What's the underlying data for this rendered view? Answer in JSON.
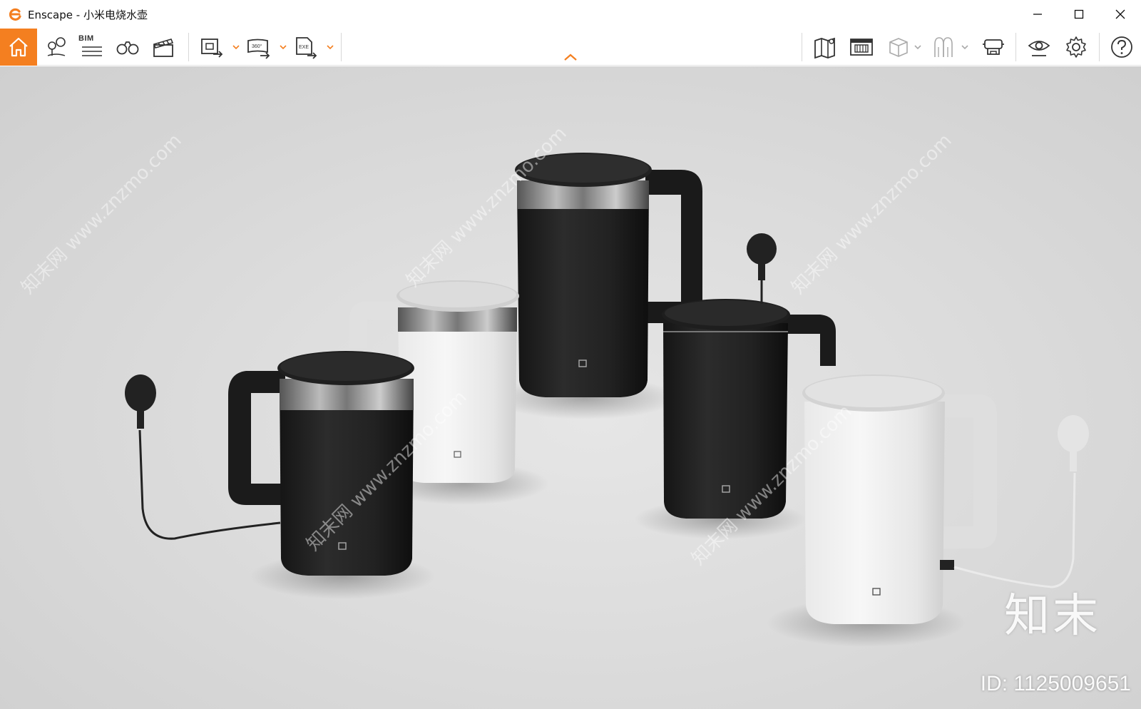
{
  "window": {
    "app_name": "Enscape",
    "separator": " - ",
    "project_name": "小米电烧水壶"
  },
  "toolbar": {
    "bim_label": "BIM",
    "accent_color": "#f47f20",
    "left_tools": [
      "home-icon",
      "location-pins-icon",
      "bim-list-icon",
      "binoculars-icon",
      "clapperboard-icon",
      "render-screenshot-icon",
      "panorama-360-icon",
      "export-exe-icon"
    ],
    "right_tools": [
      "map-icon",
      "asset-library-icon",
      "box-view-icon",
      "atmosphere-icon",
      "vr-headset-icon",
      "visual-settings-eye-icon",
      "settings-gear-icon",
      "help-icon"
    ]
  },
  "viewport": {
    "scene": "rendered kettles",
    "watermark_brand": "知末",
    "watermark_id": "ID: 1125009651",
    "watermark_text": "知末网 www.znzmo.com"
  }
}
